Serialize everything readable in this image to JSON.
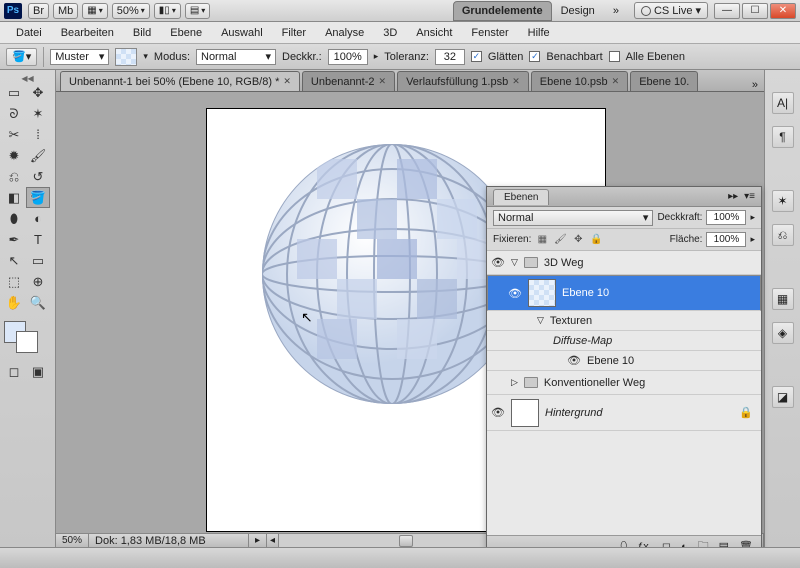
{
  "title": {
    "br": "Br",
    "mb": "Mb",
    "zoom": "50%",
    "ws_active": "Grundelemente",
    "ws_design": "Design",
    "cslive": "CS Live"
  },
  "menu": [
    "Datei",
    "Bearbeiten",
    "Bild",
    "Ebene",
    "Auswahl",
    "Filter",
    "Analyse",
    "3D",
    "Ansicht",
    "Fenster",
    "Hilfe"
  ],
  "opt": {
    "muster": "Muster",
    "modus_l": "Modus:",
    "modus_v": "Normal",
    "deck_l": "Deckkr.:",
    "deck_v": "100%",
    "tol_l": "Toleranz:",
    "tol_v": "32",
    "glatten": "Glätten",
    "benach": "Benachbart",
    "alle": "Alle Ebenen"
  },
  "tabs": [
    {
      "label": "Unbenannt-1 bei 50% (Ebene 10, RGB/8) *",
      "active": true
    },
    {
      "label": "Unbenannt-2",
      "active": false
    },
    {
      "label": "Verlaufsfüllung 1.psb",
      "active": false
    },
    {
      "label": "Ebene 10.psb",
      "active": false
    },
    {
      "label": "Ebene 10.",
      "active": false
    }
  ],
  "bottom": {
    "zoom": "50%",
    "dok": "Dok: 1,83 MB/18,8 MB"
  },
  "layers": {
    "tab": "Ebenen",
    "mode": "Normal",
    "deck_l": "Deckkraft:",
    "deck_v": "100%",
    "fix_l": "Fixieren:",
    "flache_l": "Fläche:",
    "flache_v": "100%",
    "grp": "3D Weg",
    "l1": "Ebene 10",
    "tex": "Texturen",
    "diff": "Diffuse-Map",
    "sub": "Ebene 10",
    "konv": "Konventioneller Weg",
    "bg": "Hintergrund"
  }
}
